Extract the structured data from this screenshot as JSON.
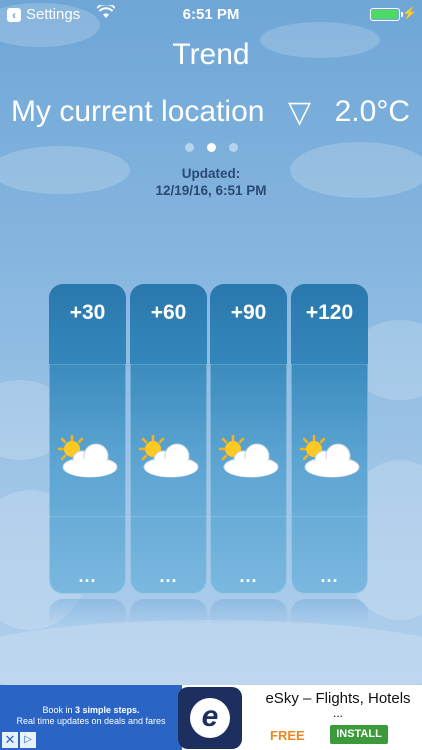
{
  "status_bar": {
    "back_app": "Settings",
    "time": "6:51 PM",
    "back_icon": "back-arrow-icon",
    "wifi_icon": "wifi-icon",
    "battery_icon": "battery-icon",
    "battery_color": "#4cd964",
    "charging_icon": "bolt-icon"
  },
  "header": {
    "title": "Trend",
    "location": "My current location",
    "location_arrow": "▽",
    "temperature": "2.0°C"
  },
  "pager": {
    "count": 3,
    "active_index": 1
  },
  "updated": {
    "label": "Updated:",
    "timestamp": "12/19/16, 6:51 PM"
  },
  "forecast": [
    {
      "label": "+30",
      "icon": "partly-cloudy-icon",
      "more": "..."
    },
    {
      "label": "+60",
      "icon": "partly-cloudy-icon",
      "more": "..."
    },
    {
      "label": "+90",
      "icon": "partly-cloudy-icon",
      "more": "..."
    },
    {
      "label": "+120",
      "icon": "partly-cloudy-icon",
      "more": "..."
    }
  ],
  "ad": {
    "line1_pre": "Book in ",
    "line1_bold": "3 simple steps.",
    "line2": "Real time updates on deals and fares",
    "app_name": "eSky – Flights, Hotels",
    "ellipsis": "...",
    "price": "FREE",
    "install_label": "INSTALL",
    "close_icon": "close-icon",
    "adchoices_icon": "adchoices-icon",
    "logo_icon": "esky-logo-icon",
    "logo_letter": "e",
    "brand_color": "#2a64c5",
    "install_color": "#3c9a3a"
  }
}
